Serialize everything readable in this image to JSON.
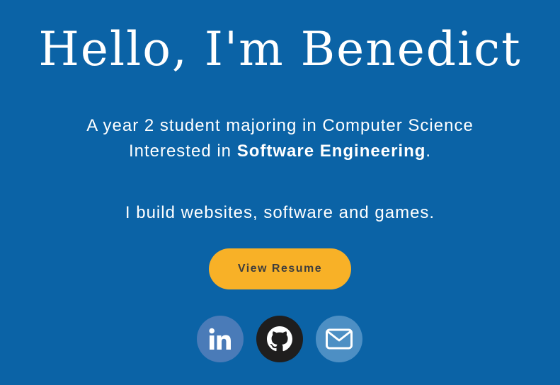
{
  "hero": {
    "title": "Hello, I'm Benedict",
    "intro_line1": "A year 2 student majoring in Computer Science",
    "intro_line2_prefix": "Interested in ",
    "intro_line2_bold": "Software Engineering",
    "intro_line2_suffix": ".",
    "tagline": "I build websites, software and games.",
    "resume_button": "View Resume"
  },
  "social": [
    {
      "name": "linkedin",
      "icon": "linkedin-icon",
      "color": "#4a7bb8"
    },
    {
      "name": "github",
      "icon": "github-icon",
      "color": "#1f1e1e"
    },
    {
      "name": "email",
      "icon": "mail-icon",
      "color": "#4d8fc4"
    }
  ],
  "colors": {
    "background": "#0b63a6",
    "accent": "#f8b127",
    "button_text": "#3d3d3d"
  }
}
